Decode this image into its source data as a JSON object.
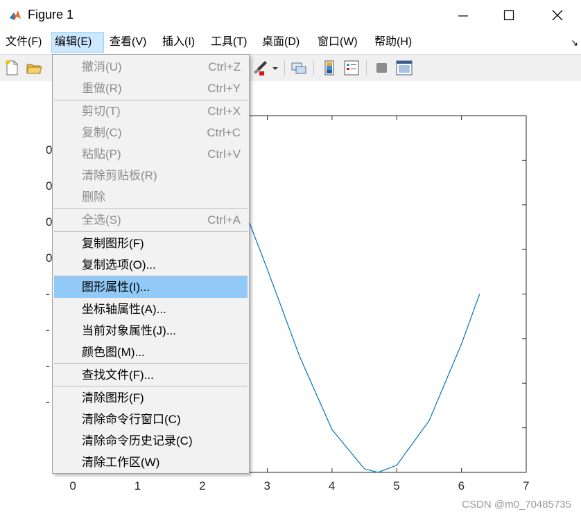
{
  "window": {
    "title": "Figure 1"
  },
  "menubar": {
    "items": [
      {
        "label": "文件(F)"
      },
      {
        "label": "编辑(E)"
      },
      {
        "label": "查看(V)"
      },
      {
        "label": "插入(I)"
      },
      {
        "label": "工具(T)"
      },
      {
        "label": "桌面(D)"
      },
      {
        "label": "窗口(W)"
      },
      {
        "label": "帮助(H)"
      }
    ],
    "overflow_glyph": "↘"
  },
  "edit_menu": {
    "items": [
      {
        "label": "撤消(U)",
        "shortcut": "Ctrl+Z"
      },
      {
        "label": "重做(R)",
        "shortcut": "Ctrl+Y"
      },
      {
        "label": "剪切(T)",
        "shortcut": "Ctrl+X"
      },
      {
        "label": "复制(C)",
        "shortcut": "Ctrl+C"
      },
      {
        "label": "粘贴(P)",
        "shortcut": "Ctrl+V"
      },
      {
        "label": "清除剪贴板(R)",
        "shortcut": ""
      },
      {
        "label": "删除",
        "shortcut": ""
      },
      {
        "label": "全选(S)",
        "shortcut": "Ctrl+A"
      },
      {
        "label": "复制图形(F)",
        "shortcut": ""
      },
      {
        "label": "复制选项(O)...",
        "shortcut": ""
      },
      {
        "label": "图形属性(I)...",
        "shortcut": ""
      },
      {
        "label": "坐标轴属性(A)...",
        "shortcut": ""
      },
      {
        "label": "当前对象属性(J)...",
        "shortcut": ""
      },
      {
        "label": "颜色图(M)...",
        "shortcut": ""
      },
      {
        "label": "查找文件(F)...",
        "shortcut": ""
      },
      {
        "label": "清除图形(F)",
        "shortcut": ""
      },
      {
        "label": "清除命令行窗口(C)",
        "shortcut": ""
      },
      {
        "label": "清除命令历史记录(C)",
        "shortcut": ""
      },
      {
        "label": "清除工作区(W)",
        "shortcut": ""
      }
    ]
  },
  "plot": {
    "x_ticks": [
      "0",
      "1",
      "2",
      "3",
      "4",
      "5",
      "6",
      "7"
    ],
    "y_tick_fragments": [
      "0",
      "0",
      "0",
      "0",
      "-",
      "-",
      "-",
      "-"
    ],
    "line_color": "#0072bd"
  },
  "chart_data": {
    "type": "line",
    "x": [
      2.65,
      3.0,
      3.5,
      4.0,
      4.5,
      4.71,
      5.0,
      5.5,
      6.0,
      6.28
    ],
    "y": [
      0.47,
      0.14,
      -0.35,
      -0.76,
      -0.98,
      -1.0,
      -0.96,
      -0.71,
      -0.28,
      0.0
    ],
    "xlim": [
      -0.1,
      7
    ],
    "xticks": [
      0,
      1,
      2,
      3,
      4,
      5,
      6,
      7
    ],
    "ylim": [
      -1,
      1
    ],
    "series_color": "#0072bd"
  },
  "watermark": {
    "text": "CSDN @m0_70485735"
  }
}
